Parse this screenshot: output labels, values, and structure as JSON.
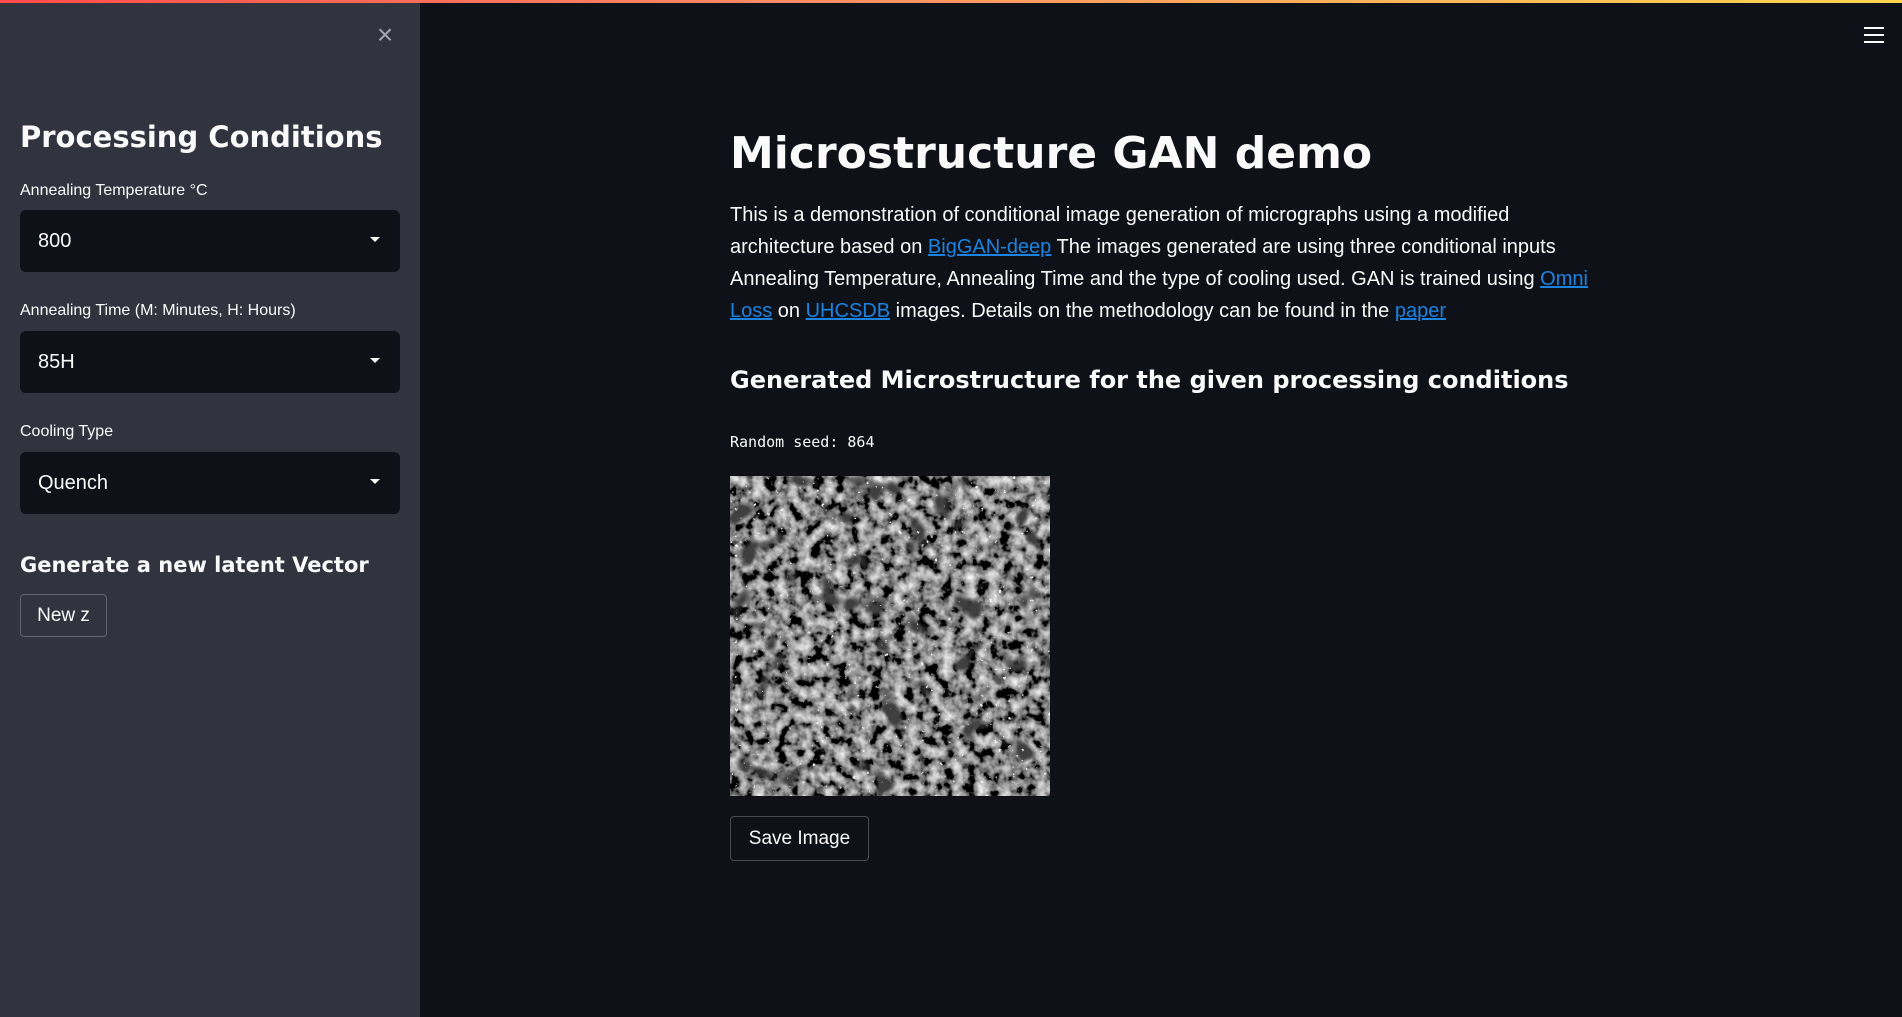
{
  "sidebar": {
    "title": "Processing Conditions",
    "temperature": {
      "label": "Annealing Temperature °C",
      "value": "800"
    },
    "time": {
      "label": "Annealing Time (M: Minutes, H: Hours)",
      "value": "85H"
    },
    "cooling": {
      "label": "Cooling Type",
      "value": "Quench"
    },
    "latent_heading": "Generate a new latent Vector",
    "new_z_label": "New z"
  },
  "main": {
    "title": "Microstructure GAN demo",
    "intro": {
      "t1": "This is a demonstration of conditional image generation of micrographs using a modified architecture based on ",
      "link_biggan": "BigGAN-deep",
      "t2": " The images generated are using three conditional inputs Annealing Temperature, Annealing Time and the type of cooling used. GAN is trained using ",
      "link_omni": "Omni Loss",
      "t3": " on ",
      "link_uhcsdb": "UHCSDB",
      "t4": " images. Details on the methodology can be found in the ",
      "link_paper": "paper"
    },
    "section_heading": "Generated Microstructure for the given processing conditions",
    "seed_text": "Random seed: 864",
    "save_label": "Save Image"
  },
  "colors": {
    "app_bg": "#0e1117",
    "sidebar_bg": "#31333f",
    "link": "#1c83e1",
    "text": "#fafafa"
  },
  "icons": {
    "close": "close-icon",
    "menu": "hamburger-menu-icon",
    "dropdown": "chevron-down-icon"
  }
}
